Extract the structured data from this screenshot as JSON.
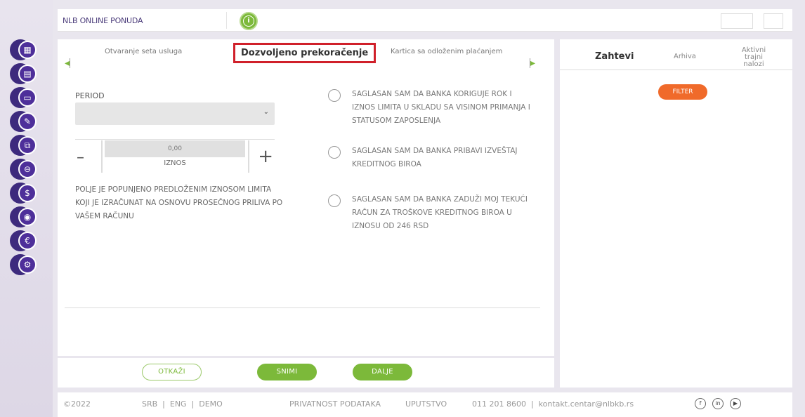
{
  "header": {
    "title": "NLB ONLINE PONUDA",
    "info_icon": "i"
  },
  "sidebar_icons": [
    {
      "name": "chart-icon",
      "glyph": "▦"
    },
    {
      "name": "clipboard-icon",
      "glyph": "▤"
    },
    {
      "name": "card-icon",
      "glyph": "▭"
    },
    {
      "name": "pen-icon",
      "glyph": "✎"
    },
    {
      "name": "cards-icon",
      "glyph": "⧉"
    },
    {
      "name": "minus-card-icon",
      "glyph": "⊖"
    },
    {
      "name": "dollar-icon",
      "glyph": "$"
    },
    {
      "name": "location-pin-icon",
      "glyph": "◉"
    },
    {
      "name": "euro-icon",
      "glyph": "€"
    },
    {
      "name": "settings-icon",
      "glyph": "⚙"
    }
  ],
  "tabs": {
    "prev": "Otvaranje seta usluga",
    "active": "Dozvoljeno prekoračenje",
    "next": "Kartica sa odloženim plaćanjem"
  },
  "form": {
    "period_label": "PERIOD",
    "select_chevron": "⌄",
    "amount_value": "0,00",
    "amount_label": "IZNOS",
    "minus": "–",
    "plus": "+",
    "note": "POLJE JE POPUNJENO PREDLOŽENIM IZNOSOM LIMITA KOJI JE IZRAČUNAT NA OSNOVU PROSEČNOG PRILIVA PO VAŠEM RAČUNU"
  },
  "consents": [
    "SAGLASAN SAM DA BANKA KORIGUJE ROK I IZNOS LIMITA U SKLADU SA VISINOM PRIMANJA I STATUSOM ZAPOSLENJA",
    "SAGLASAN SAM DA BANKA PRIBAVI IZVEŠTAJ KREDITNOG BIROA",
    "SAGLASAN SAM DA BANKA ZADUŽI MOJ TEKUĆI RAČUN ZA TROŠKOVE KREDITNOG BIROA U IZNOSU OD 246 RSD"
  ],
  "buttons": {
    "cancel": "OTKAŽI",
    "save": "SNIMI",
    "next": "DALJE"
  },
  "right_panel": {
    "tab_requests": "Zahtevi",
    "tab_archive": "Arhiva",
    "tab_orders_line1": "Aktivni trajni",
    "tab_orders_line2": "nalozi",
    "filter": "FILTER"
  },
  "footer": {
    "copyright": "©2022",
    "languages": "SRB  |  ENG  |  DEMO",
    "privacy": "PRIVATNOST PODATAKA",
    "guide": "UPUTSTVO",
    "contact": "011 201 8600  |  kontakt.centar@nlbkb.rs",
    "social": [
      "f",
      "in",
      "▶"
    ]
  },
  "colors": {
    "brand_purple": "#4e2f9a",
    "green": "#7cb93a",
    "orange": "#f06a2a",
    "highlight_red": "#d0202a"
  }
}
